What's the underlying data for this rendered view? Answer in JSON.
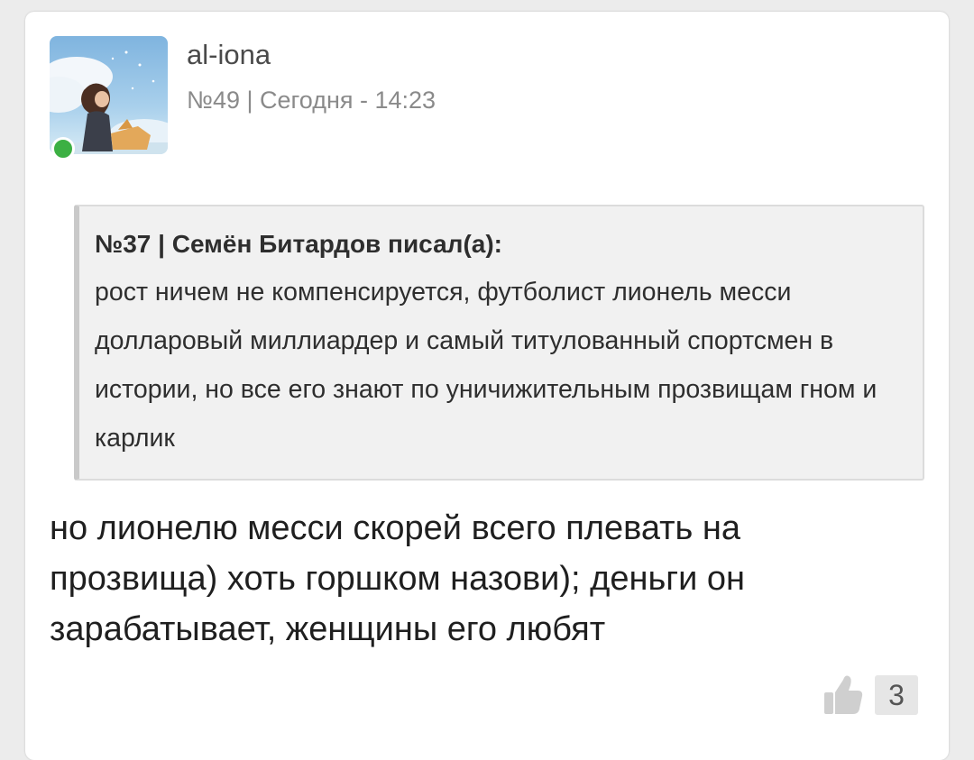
{
  "post": {
    "username": "al-iona",
    "meta": "№49 | Сегодня - 14:23",
    "online_color": "#3cb043",
    "avatar_alt": "user-avatar",
    "quote": {
      "header": "№37 | Семён Битардов писал(а):",
      "text": "рост ничем не компенсируется, футболист лионель месси долларовый миллиардер и самый титулованный спортсмен в истории, но все его знают по уничижительным прозвищам гном и карлик"
    },
    "text": "но лионелю месси скорей всего плевать на прозвища) хоть горшком назови); деньги он зарабатывает, женщины его любят",
    "likes": {
      "icon": "thumbs-up-icon",
      "count": "3"
    }
  }
}
